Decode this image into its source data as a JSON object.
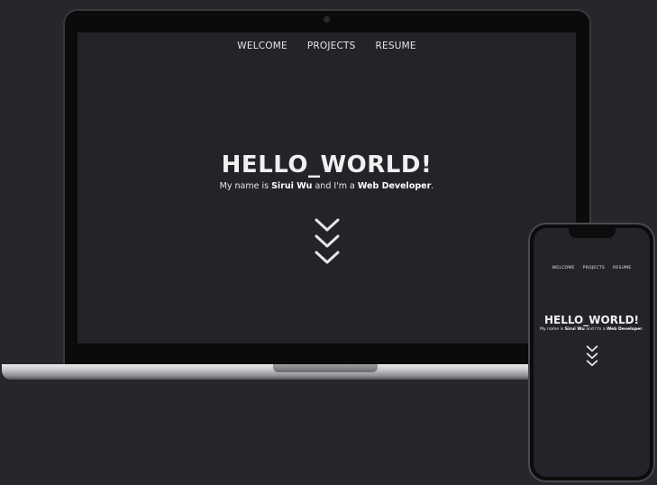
{
  "nav": {
    "welcome": "WELCOME",
    "projects": "PROJECTS",
    "resume": "RESUME"
  },
  "hero": {
    "title": "HELLO_WORLD!",
    "sub_prefix": "My name is ",
    "name": "Sirui Wu",
    "sub_middle": " and I'm a ",
    "role": "Web Developer",
    "sub_suffix": "."
  },
  "icons": {
    "scroll_down": "triple-chevron-down-icon",
    "camera": "camera-icon"
  },
  "colors": {
    "page_bg": "#26272b",
    "screen_bg": "#232429",
    "text": "#e6e6e6"
  }
}
